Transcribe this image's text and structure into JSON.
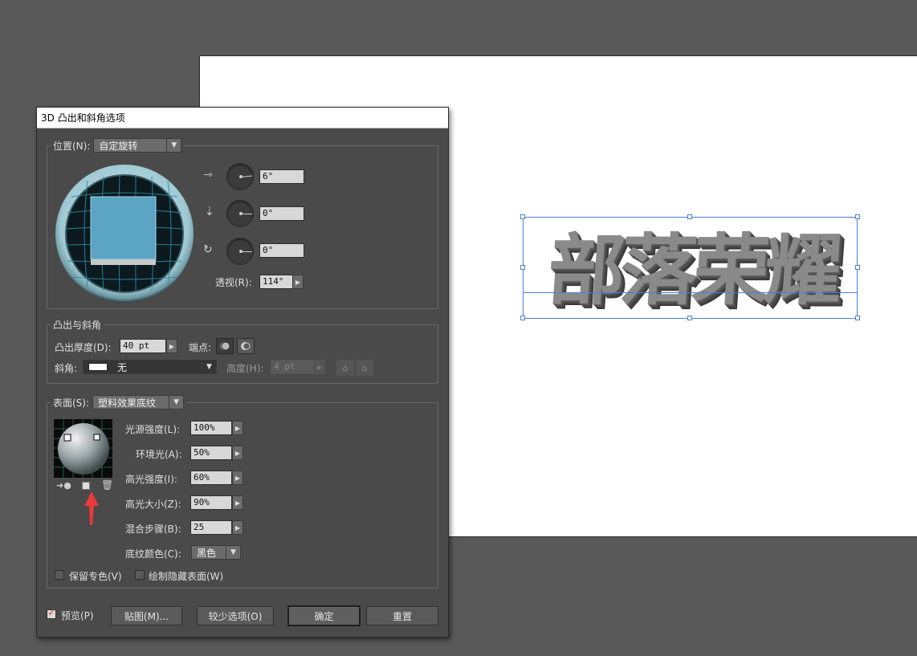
{
  "dialog": {
    "title": "3D 凸出和斜角选项",
    "position": {
      "label": "位置(N):",
      "preset": "自定旋转",
      "x_rotation": "6°",
      "y_rotation": "0°",
      "z_rotation": "0°",
      "perspective_label": "透视(R):",
      "perspective": "114°"
    },
    "extrude": {
      "group_label": "凸出与斜角",
      "depth_label": "凸出厚度(D):",
      "depth": "40 pt",
      "cap_label": "端点:",
      "bevel_label": "斜角:",
      "bevel": "无",
      "height_label": "高度(H):",
      "height": "4 pt"
    },
    "surface": {
      "label": "表面(S):",
      "type": "塑料效果底纹",
      "light_intensity_label": "光源强度(L):",
      "light_intensity": "100%",
      "ambient_label": "环境光(A):",
      "ambient": "50%",
      "highlight_intensity_label": "高光强度(I):",
      "highlight_intensity": "60%",
      "highlight_size_label": "高光大小(Z):",
      "highlight_size": "90%",
      "blend_steps_label": "混合步骤(B):",
      "blend_steps": "25",
      "shade_color_label": "底纹颜色(C):",
      "shade_color": "黑色",
      "preserve_spot_label": "保留专色(V)",
      "draw_hidden_label": "绘制隐藏表面(W)"
    },
    "footer": {
      "preview_label": "预览(P)",
      "preview_checked": true,
      "map_art_label": "贴图(M)...",
      "fewer_options_label": "较少选项(O)",
      "ok_label": "确定",
      "reset_label": "重置"
    }
  },
  "artboard": {
    "art_text": "部落荣耀"
  },
  "colors": {
    "dialog_bg": "#4a4a4a",
    "canvas_bg": "#595959",
    "selection": "#4a7fd6",
    "annotation_arrow": "#e83a3a",
    "preview_cube": "#5ba4c4"
  },
  "icons": [
    "x-axis-rotate-icon",
    "y-axis-rotate-icon",
    "z-axis-rotate-icon",
    "cap-on-icon",
    "cap-off-icon",
    "bevel-out-icon",
    "bevel-in-icon",
    "move-light-back-icon",
    "new-light-icon",
    "delete-light-icon"
  ]
}
